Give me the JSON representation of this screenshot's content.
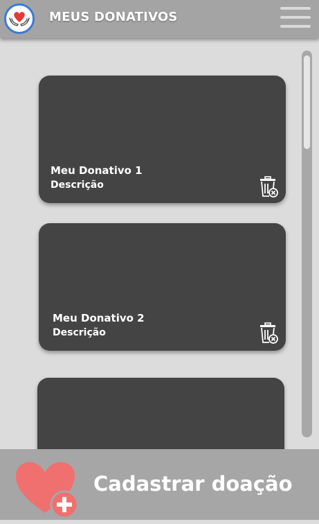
{
  "header": {
    "title": "MEUS DONATIVOS",
    "logo_icon": "heart-hands-logo-icon",
    "menu_icon": "hamburger-menu-icon"
  },
  "donations": [
    {
      "title": "Meu Donativo 1",
      "description": "Descrição"
    },
    {
      "title": "Meu Donativo 2",
      "description": "Descrição"
    },
    {
      "title": "",
      "description": ""
    }
  ],
  "bottom_bar": {
    "label": "Cadastrar doação",
    "icon": "heart-plus-icon"
  },
  "colors": {
    "header_bg": "#a4a4a4",
    "page_bg": "#dcdcdc",
    "card_bg": "#444444",
    "bottom_bg": "#a6a6a6",
    "accent_heart": "#f07070",
    "logo_heart": "#e53935",
    "logo_border": "#3a7bd5"
  }
}
